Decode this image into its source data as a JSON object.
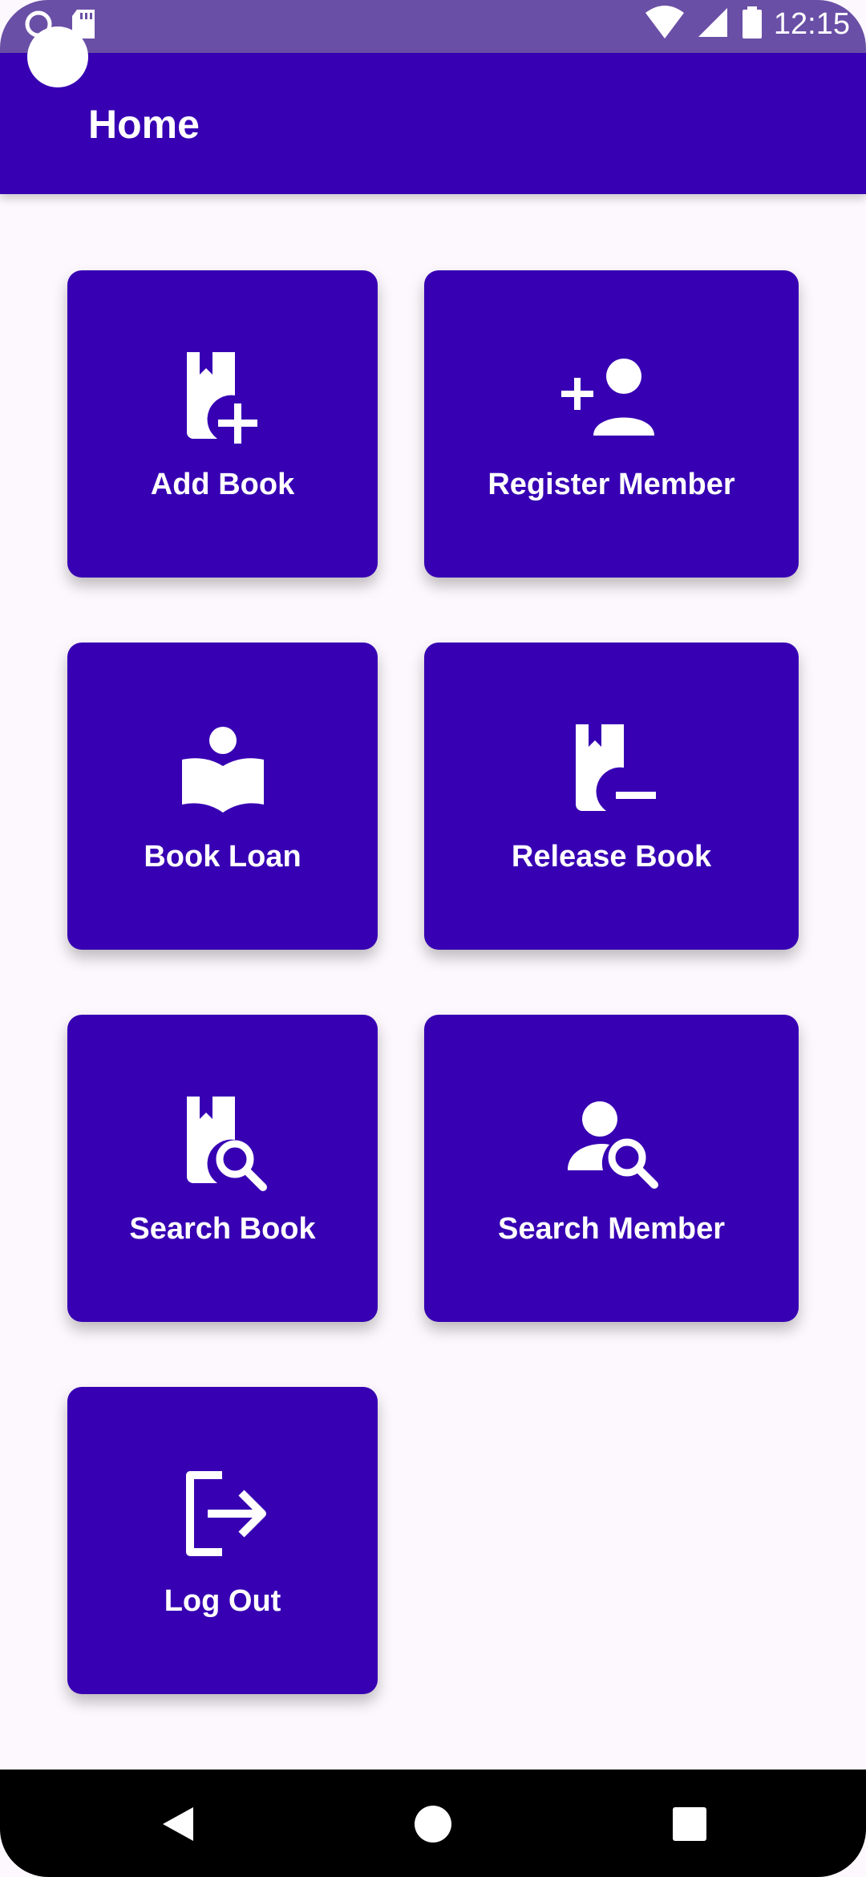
{
  "status_bar": {
    "time": "12:15",
    "icons": [
      "notification-icon",
      "sd-card-icon",
      "wifi-icon",
      "signal-icon",
      "battery-icon"
    ]
  },
  "app_bar": {
    "title": "Home"
  },
  "tiles": [
    {
      "label": "Add Book",
      "icon": "add-book-icon"
    },
    {
      "label": "Register Member",
      "icon": "add-person-icon"
    },
    {
      "label": "Book Loan",
      "icon": "book-loan-icon"
    },
    {
      "label": "Release Book",
      "icon": "remove-book-icon"
    },
    {
      "label": "Search Book",
      "icon": "search-book-icon"
    },
    {
      "label": "Search Member",
      "icon": "search-member-icon"
    },
    {
      "label": "Log Out",
      "icon": "logout-icon"
    }
  ],
  "nav_bar": {
    "buttons": [
      "back-icon",
      "home-icon",
      "recents-icon"
    ]
  },
  "colors": {
    "primary": "#3700B3",
    "background": "#FDF8FD",
    "status_bar": "#6A4FA6",
    "on_primary": "#FFFFFF"
  }
}
